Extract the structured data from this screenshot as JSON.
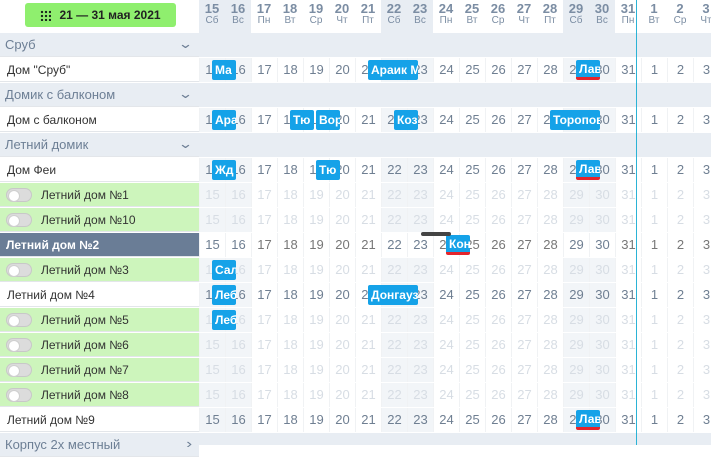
{
  "date_range": "21 — 31 мая 2021",
  "days": [
    {
      "d": "15",
      "w": "Сб"
    },
    {
      "d": "16",
      "w": "Вс"
    },
    {
      "d": "17",
      "w": "Пн"
    },
    {
      "d": "18",
      "w": "Вт"
    },
    {
      "d": "19",
      "w": "Ср"
    },
    {
      "d": "20",
      "w": "Чт"
    },
    {
      "d": "21",
      "w": "Пт"
    },
    {
      "d": "22",
      "w": "Сб"
    },
    {
      "d": "23",
      "w": "Вс"
    },
    {
      "d": "24",
      "w": "Пн"
    },
    {
      "d": "25",
      "w": "Вт"
    },
    {
      "d": "26",
      "w": "Ср"
    },
    {
      "d": "27",
      "w": "Чт"
    },
    {
      "d": "28",
      "w": "Пт"
    },
    {
      "d": "29",
      "w": "Сб"
    },
    {
      "d": "30",
      "w": "Вс"
    },
    {
      "d": "31",
      "w": "Пн"
    },
    {
      "d": "1",
      "w": "Вт"
    },
    {
      "d": "2",
      "w": "Ср"
    },
    {
      "d": "3",
      "w": "Чт"
    }
  ],
  "rows": [
    {
      "type": "group",
      "label": "Сруб"
    },
    {
      "type": "normal",
      "label": "Дом \"Сруб\""
    },
    {
      "type": "group",
      "label": "Домик с балконом"
    },
    {
      "type": "normal",
      "label": "Дом с балконом"
    },
    {
      "type": "group",
      "label": "Летний домик"
    },
    {
      "type": "normal",
      "label": "Дом Феи"
    },
    {
      "type": "green",
      "label": "Летний дом №1"
    },
    {
      "type": "green",
      "label": "Летний дом №10"
    },
    {
      "type": "selected",
      "label": "Летний дом №2"
    },
    {
      "type": "green",
      "label": "Летний дом №3"
    },
    {
      "type": "normal",
      "label": "Летний дом №4"
    },
    {
      "type": "green",
      "label": "Летний дом №5"
    },
    {
      "type": "green",
      "label": "Летний дом №6"
    },
    {
      "type": "green",
      "label": "Летний дом №7"
    },
    {
      "type": "green",
      "label": "Летний дом №8"
    },
    {
      "type": "normal",
      "label": "Летний дом №9"
    },
    {
      "type": "group",
      "label": "Корпус 2х местный"
    }
  ],
  "bookings": [
    {
      "row": 1,
      "start": 0,
      "span": 1,
      "label": "Ма",
      "red": false
    },
    {
      "row": 1,
      "start": 6,
      "span": 2,
      "label": "Араик М",
      "red": false
    },
    {
      "row": 1,
      "start": 14,
      "span": 1,
      "label": "Лав",
      "red": true
    },
    {
      "row": 3,
      "start": 0,
      "span": 1,
      "label": "Ара",
      "red": false
    },
    {
      "row": 3,
      "start": 3,
      "span": 1,
      "label": "Тю",
      "red": false
    },
    {
      "row": 3,
      "start": 4,
      "span": 1,
      "label": "Вор",
      "red": false
    },
    {
      "row": 3,
      "start": 7,
      "span": 1,
      "label": "Коз",
      "red": false
    },
    {
      "row": 3,
      "start": 13,
      "span": 2,
      "label": "Торопов",
      "red": false
    },
    {
      "row": 5,
      "start": 0,
      "span": 1,
      "label": "Жд",
      "red": false
    },
    {
      "row": 5,
      "start": 4,
      "span": 1,
      "label": "Тю",
      "red": false
    },
    {
      "row": 5,
      "start": 14,
      "span": 1,
      "label": "Лав",
      "red": true
    },
    {
      "row": 8,
      "start": 9,
      "span": 1,
      "label": "Кон",
      "red": true
    },
    {
      "row": 9,
      "start": 0,
      "span": 1,
      "label": "Сал",
      "red": false
    },
    {
      "row": 10,
      "start": 0,
      "span": 1,
      "label": "Леб",
      "red": false
    },
    {
      "row": 10,
      "start": 6,
      "span": 2,
      "label": "Донгауз",
      "red": false
    },
    {
      "row": 11,
      "start": 0,
      "span": 1,
      "label": "Леб",
      "red": false
    },
    {
      "row": 15,
      "start": 14,
      "span": 1,
      "label": "Лав",
      "red": true
    }
  ]
}
